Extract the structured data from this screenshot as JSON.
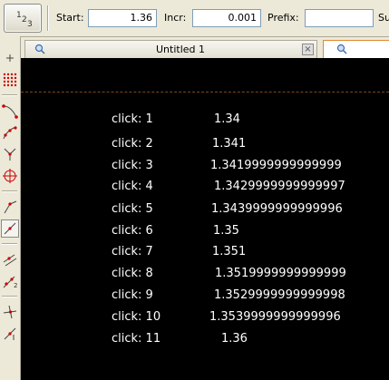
{
  "toolbar": {
    "sequence_tool_text": [
      "1",
      "2",
      "3"
    ],
    "start_label": "Start:",
    "start_value": "1.36",
    "incr_label": "Incr:",
    "incr_value": "0.001",
    "prefix_label": "Prefix:",
    "prefix_value": "",
    "suffix_label_partial": "Su"
  },
  "tabs": [
    {
      "title": "Untitled 1"
    },
    {
      "title": ""
    }
  ],
  "palette": {
    "icons": [
      "add-icon",
      "dot-grid-icon",
      "curve-tool-icon",
      "point-curve-icon",
      "branch-tool-icon",
      "circle-point-icon",
      "angle-tool-icon",
      "segment-tool-icon",
      "transform-tool-icon",
      "numbered-points-icon",
      "intersect-tool-icon",
      "line-tool-icon"
    ]
  },
  "clicks": [
    {
      "label": "click: 1",
      "value": "1.34"
    },
    {
      "label": "click: 2",
      "value": "1.341"
    },
    {
      "label": "click: 3",
      "value": "1.3419999999999999"
    },
    {
      "label": "click: 4",
      "value": "1.3429999999999997"
    },
    {
      "label": "click: 5",
      "value": "1.3439999999999996"
    },
    {
      "label": "click: 6",
      "value": "1.35"
    },
    {
      "label": "click: 7",
      "value": "1.351"
    },
    {
      "label": "click: 8",
      "value": "1.3519999999999999"
    },
    {
      "label": "click: 9",
      "value": "1.3529999999999998"
    },
    {
      "label": "click: 10",
      "value": "1.3539999999999996"
    },
    {
      "label": "click: 11",
      "value": "1.36"
    }
  ],
  "colors": {
    "canvas_bg": "#000000",
    "text": "#ffffff",
    "active_tab_border": "#e08a2e",
    "palette_red": "#cc0000"
  }
}
